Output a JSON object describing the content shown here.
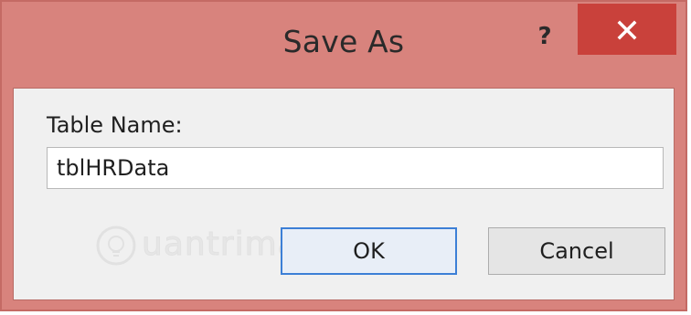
{
  "dialog": {
    "title": "Save As",
    "help_label": "?",
    "field_label": "Table Name:",
    "field_value": "tblHRData",
    "ok_label": "OK",
    "cancel_label": "Cancel"
  },
  "watermark": {
    "text": "uantrimang"
  },
  "colors": {
    "titlebar": "#d8837d",
    "close_button": "#c9413b",
    "client_bg": "#f0f0f0",
    "focus_border": "#3c7fd6"
  },
  "icons": {
    "close": "close-icon",
    "help": "help-icon",
    "watermark_logo": "bulb-logo-icon"
  }
}
